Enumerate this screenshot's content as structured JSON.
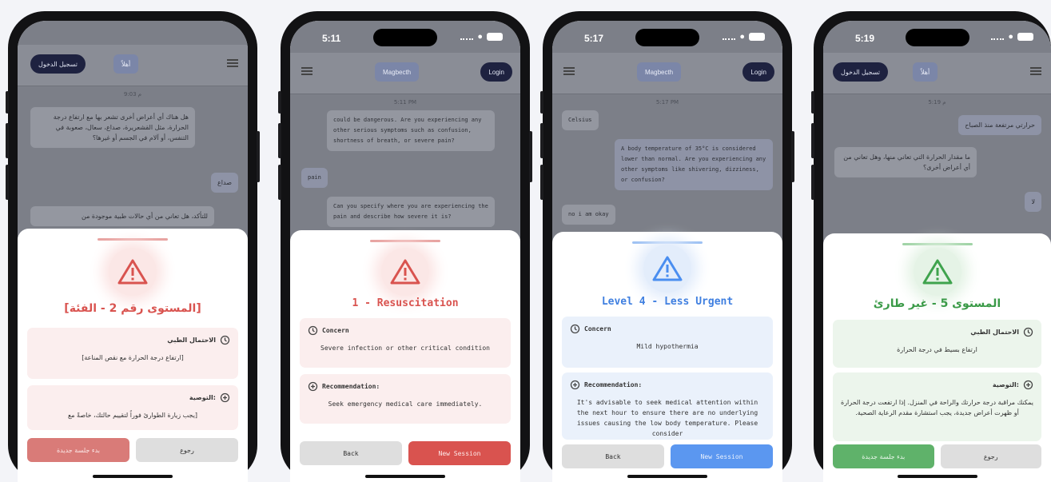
{
  "phones": [
    {
      "status_time": "",
      "appbar": {
        "left_pill": "تسجيل الدخول",
        "center_pill": "أهلاً"
      },
      "chat": {
        "timestamp": "9:03 م",
        "bubble1": "هل هناك أي أعراض أخرى تشعر بها مع ارتفاع درجة الحرارة، مثل القشعريرة، صداع، سعال، صعوبة في التنفس، أو آلام في الجسم أو غيرها؟",
        "bubble2": "صداع",
        "bubble3": "للتأكد، هل تعاني من أي حالات طبية موجودة من"
      },
      "sheet": {
        "title": "[المستوى رقم 2 - الفئة]",
        "card1_label": "الاحتمال الطبي",
        "card1_text": "[ارتفاع درجة الحرارة مع نقص المناعة]",
        "card2_label": "التوصية:",
        "card2_text": "[يجب زيارة الطوارئ فوراً لتقييم حالتك، خاصةً مع",
        "btn_back": "رجوع",
        "btn_new": "بدء جلسة جديدة"
      }
    },
    {
      "status_time": "5:11",
      "appbar": {
        "left_pill": "Magbecth",
        "right_pill": "Login"
      },
      "chat": {
        "timestamp": "5:11 PM",
        "bubble1": "could be dangerous. Are you experiencing any other serious symptoms such as confusion, shortness of breath, or severe pain?",
        "bubble2": "pain",
        "bubble3": "Can you specify where you are experiencing the pain and describe how severe it is?"
      },
      "sheet": {
        "title": "1 - Resuscitation",
        "card1_label": "Concern",
        "card1_text": "Severe infection or other critical condition",
        "card2_label": "Recommendation:",
        "card2_text": "Seek emergency medical care immediately.",
        "btn_back": "Back",
        "btn_new": "New Session"
      }
    },
    {
      "status_time": "5:17",
      "appbar": {
        "left_pill": "Magbecth",
        "right_pill": "Login"
      },
      "chat": {
        "timestamp": "5:17 PM",
        "bubble0": "Celsius",
        "bubble1": "A body temperature of 35°C is considered lower than normal. Are you experiencing any other symptoms like shivering, dizziness, or confusion?",
        "bubble2": "no i am okay"
      },
      "sheet": {
        "title": "Level 4 - Less Urgent",
        "card1_label": "Concern",
        "card1_text": "Mild hypothermia",
        "card2_label": "Recommendation:",
        "card2_text": "It's advisable to seek medical attention within the next hour to ensure there are no underlying issues causing the low body temperature. Please consider",
        "btn_back": "Back",
        "btn_new": "New Session"
      }
    },
    {
      "status_time": "5:19",
      "appbar": {
        "left_pill": "تسجيل الدخول",
        "center_pill": "أهلاً"
      },
      "chat": {
        "timestamp": "5:19 م",
        "bubble1": "حرارتي مرتفعة منذ الصباح",
        "bubble2": "ما مقدار الحرارة التي تعاني منها، وهل تعاني من أي أعراض أخرى؟",
        "bubble3": "لا"
      },
      "sheet": {
        "title": "المستوى 5 - غير طارئ",
        "card1_label": "الاحتمال الطبي",
        "card1_text": "ارتفاع بسيط في درجة الحرارة",
        "card2_label": "التوصية:",
        "card2_text": "يمكنك مراقبة درجة حرارتك والراحة في المنزل. إذا ارتفعت درجة الحرارة أو ظهرت أعراض جديدة، يجب استشارة مقدم الرعاية الصحية.",
        "btn_back": "رجوع",
        "btn_new": "بدء جلسة جديدة"
      }
    }
  ],
  "colors": {
    "red": "#d9534f",
    "red_card": "#fbeeee",
    "blue": "#4a8ef0",
    "blue_card": "#eaf1fb",
    "green": "#3fa34d",
    "green_card": "#ecf5ec"
  }
}
